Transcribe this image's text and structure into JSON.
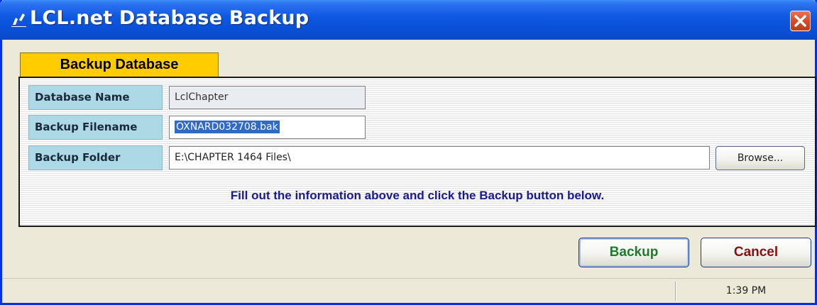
{
  "window": {
    "title": "LCL.net Database Backup",
    "icon": "app-icon",
    "close_icon": "close-icon"
  },
  "tab": {
    "label": "Backup Database"
  },
  "form": {
    "database_name": {
      "label": "Database Name",
      "value": "LclChapter"
    },
    "backup_filename": {
      "label": "Backup Filename",
      "value": "OXNARD032708.bak"
    },
    "backup_folder": {
      "label": "Backup Folder",
      "value": "E:\\CHAPTER 1464 Files\\"
    },
    "browse_label": "Browse...",
    "hint": "Fill out the information above and click the Backup button below."
  },
  "actions": {
    "backup_label": "Backup",
    "cancel_label": "Cancel"
  },
  "statusbar": {
    "time": "1:39 PM"
  },
  "colors": {
    "title_bar": "#0a4fd6",
    "tab_background": "#ffcc00",
    "label_background": "#add8e6",
    "hint_text": "#1a1a8c",
    "backup_text": "#1f7a2e",
    "cancel_text": "#8a0f0f",
    "close_button": "#d94a25"
  }
}
